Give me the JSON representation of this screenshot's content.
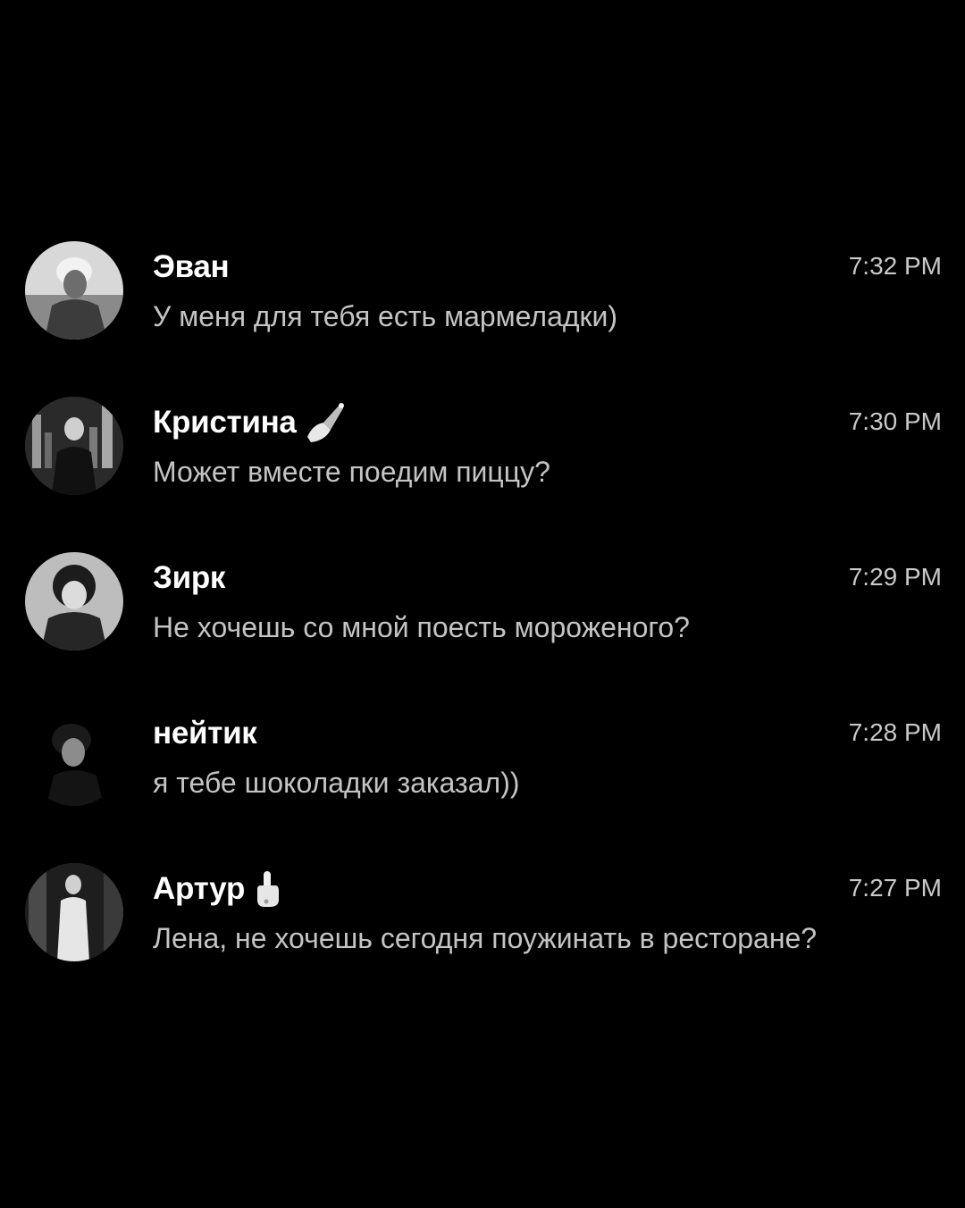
{
  "chats": [
    {
      "name": "Эван",
      "emoji": "",
      "time": "7:32 PM",
      "message": "У меня для тебя есть мармеладки)"
    },
    {
      "name": "Кристина",
      "emoji": "nail-polish-icon",
      "time": "7:30 PM",
      "message": "Может вместе поедим пиццу?"
    },
    {
      "name": "Зирк",
      "emoji": "",
      "time": "7:29 PM",
      "message": "Не хочешь со мной поесть мороженого?"
    },
    {
      "name": "нейтик",
      "emoji": "",
      "time": "7:28 PM",
      "message": "я тебе шоколадки заказал))"
    },
    {
      "name": "Артур",
      "emoji": "middle-finger-icon",
      "time": "7:27 PM",
      "message": "Лена, не хочешь сегодня поужинать в ресторане?"
    }
  ],
  "colors": {
    "background": "#000000",
    "name": "#ffffff",
    "message": "#c4c4c4",
    "time": "#c9c9c9"
  }
}
